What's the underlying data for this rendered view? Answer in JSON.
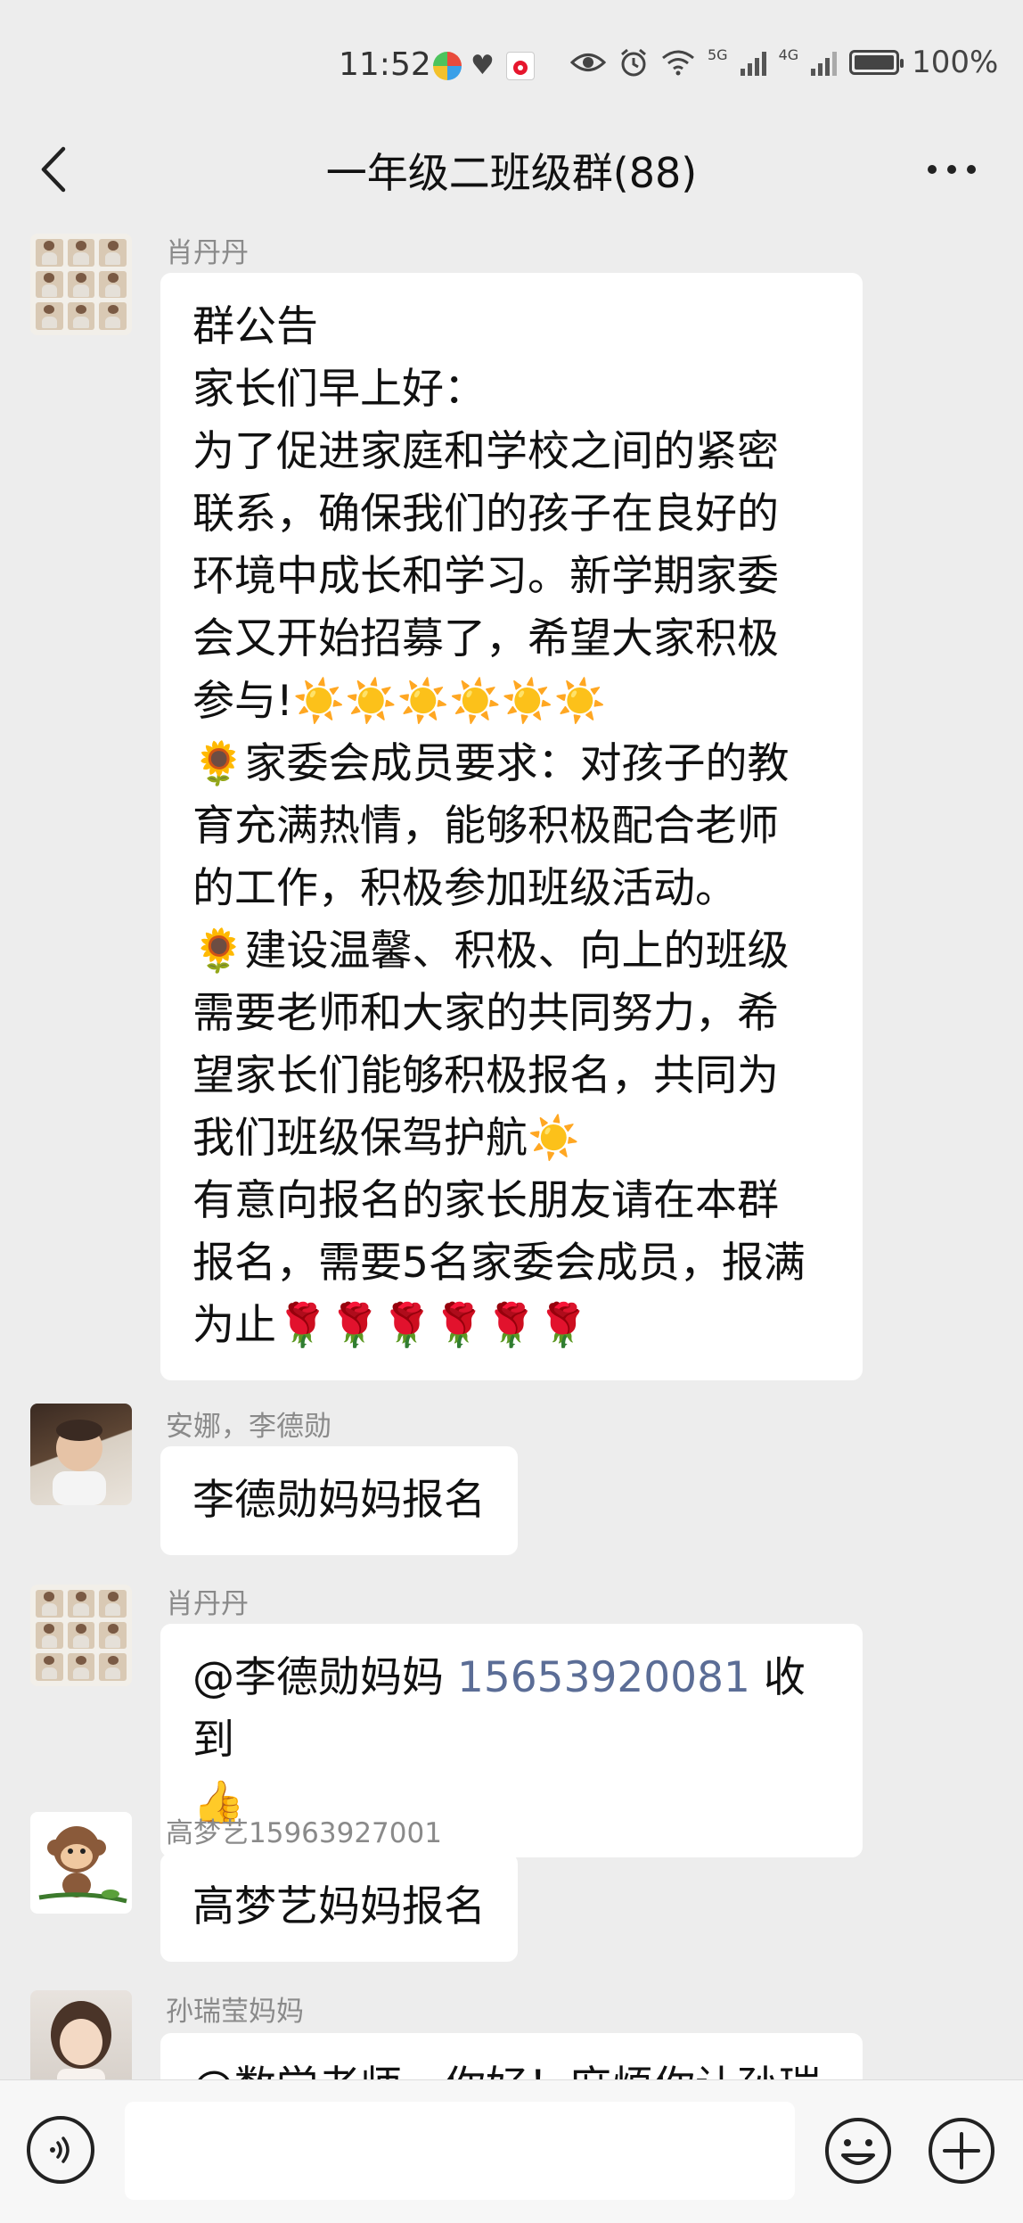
{
  "status_bar": {
    "time": "11:52",
    "network_label_1": "5G",
    "network_label_2": "4G",
    "battery": "100%"
  },
  "header": {
    "title": "一年级二班级群(88)",
    "back_icon": "chevron-left-icon",
    "more_icon": "more-dots-icon"
  },
  "messages": [
    {
      "sender": "肖丹丹",
      "lines": [
        "群公告",
        "家长们早上好：",
        "为了促进家庭和学校之间的紧密",
        "联系，确保我们的孩子在良好的",
        "环境中成长和学习。新学期家委",
        "会又开始招募了，希望大家积极",
        "参与!☀️☀️☀️☀️☀️☀️",
        "🌻家委会成员要求：对孩子的教",
        "育充满热情，能够积极配合老师",
        "的工作，积极参加班级活动。",
        "🌻建设温馨、积极、向上的班级",
        "需要老师和大家的共同努力，希",
        "望家长们能够积极报名，共同为",
        "我们班级保驾护航☀️",
        "有意向报名的家长朋友请在本群",
        "报名，需要5名家委会成员，报满",
        "为止🌹🌹🌹🌹🌹🌹"
      ]
    },
    {
      "sender": "安娜，李德勋",
      "text": "李德勋妈妈报名"
    },
    {
      "sender": "肖丹丹",
      "mention": "@李德勋妈妈 ",
      "phone": "15653920081",
      "after": "  收到",
      "line2": "👍"
    },
    {
      "sender": "高梦艺15963927001",
      "text": "高梦艺妈妈报名"
    },
    {
      "sender": "孙瑞莹妈妈",
      "text": "@数学老师，你好！麻烦你让孙瑞"
    }
  ],
  "input_bar": {
    "voice_icon": "voice-icon",
    "placeholder": "",
    "emoji_icon": "emoji-icon",
    "plus_icon": "plus-icon"
  }
}
